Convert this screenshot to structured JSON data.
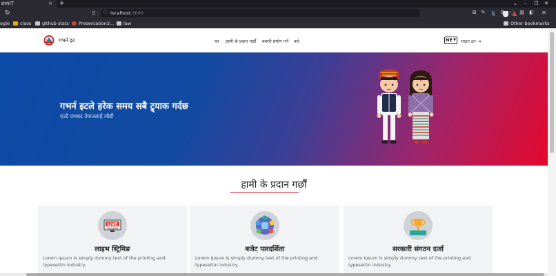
{
  "browser": {
    "tab_title": "ernIT",
    "tab_close": "×",
    "new_tab": "+",
    "url_host": "localhost",
    "url_port": ":3000",
    "bookmarks": [
      {
        "label": "ogle"
      },
      {
        "label": "class"
      },
      {
        "label": "github stats"
      },
      {
        "label": "Presentation3..."
      },
      {
        "label": "law"
      }
    ],
    "other_bookmarks": "Other bookmarks"
  },
  "nav": {
    "brand": "गभर्न इट",
    "menu": [
      "घर",
      "हामी के प्रदान गर्छौं",
      "कसरी प्रयोग गर्ने",
      "बारे"
    ],
    "language": "NE",
    "signin": "साइन इन"
  },
  "hero": {
    "title": "गभर्न इटले हरेक समय सबै ट्र्याक गर्दछ",
    "subtitle": "एउटै एपबाट नेपाललाई जोडौं"
  },
  "services": {
    "title": "हामी के प्रदान गर्छौं",
    "cards": [
      {
        "title": "लाइभ स्ट्रिमिङ",
        "body": "Lorem Ipsum is simply dummy text of the printing and typesettin industry.",
        "icon": "live-streaming-icon",
        "badge": "LIVE",
        "badge_sub": "STREAMING"
      },
      {
        "title": "बजेट पारदर्शिता",
        "body": "Lorem Ipsum is simply dummy text of the printing and typesettin industry.",
        "icon": "budget-transparency-icon"
      },
      {
        "title": "सरकारी संगठन दर्जा",
        "body": "Lorem Ipsum is simply dummy text of the printing and typesettin industry.",
        "icon": "trophy-icon"
      }
    ]
  },
  "colors": {
    "hero_start": "#0c4aa8",
    "hero_end": "#e5082c",
    "accent": "#c8102e"
  }
}
